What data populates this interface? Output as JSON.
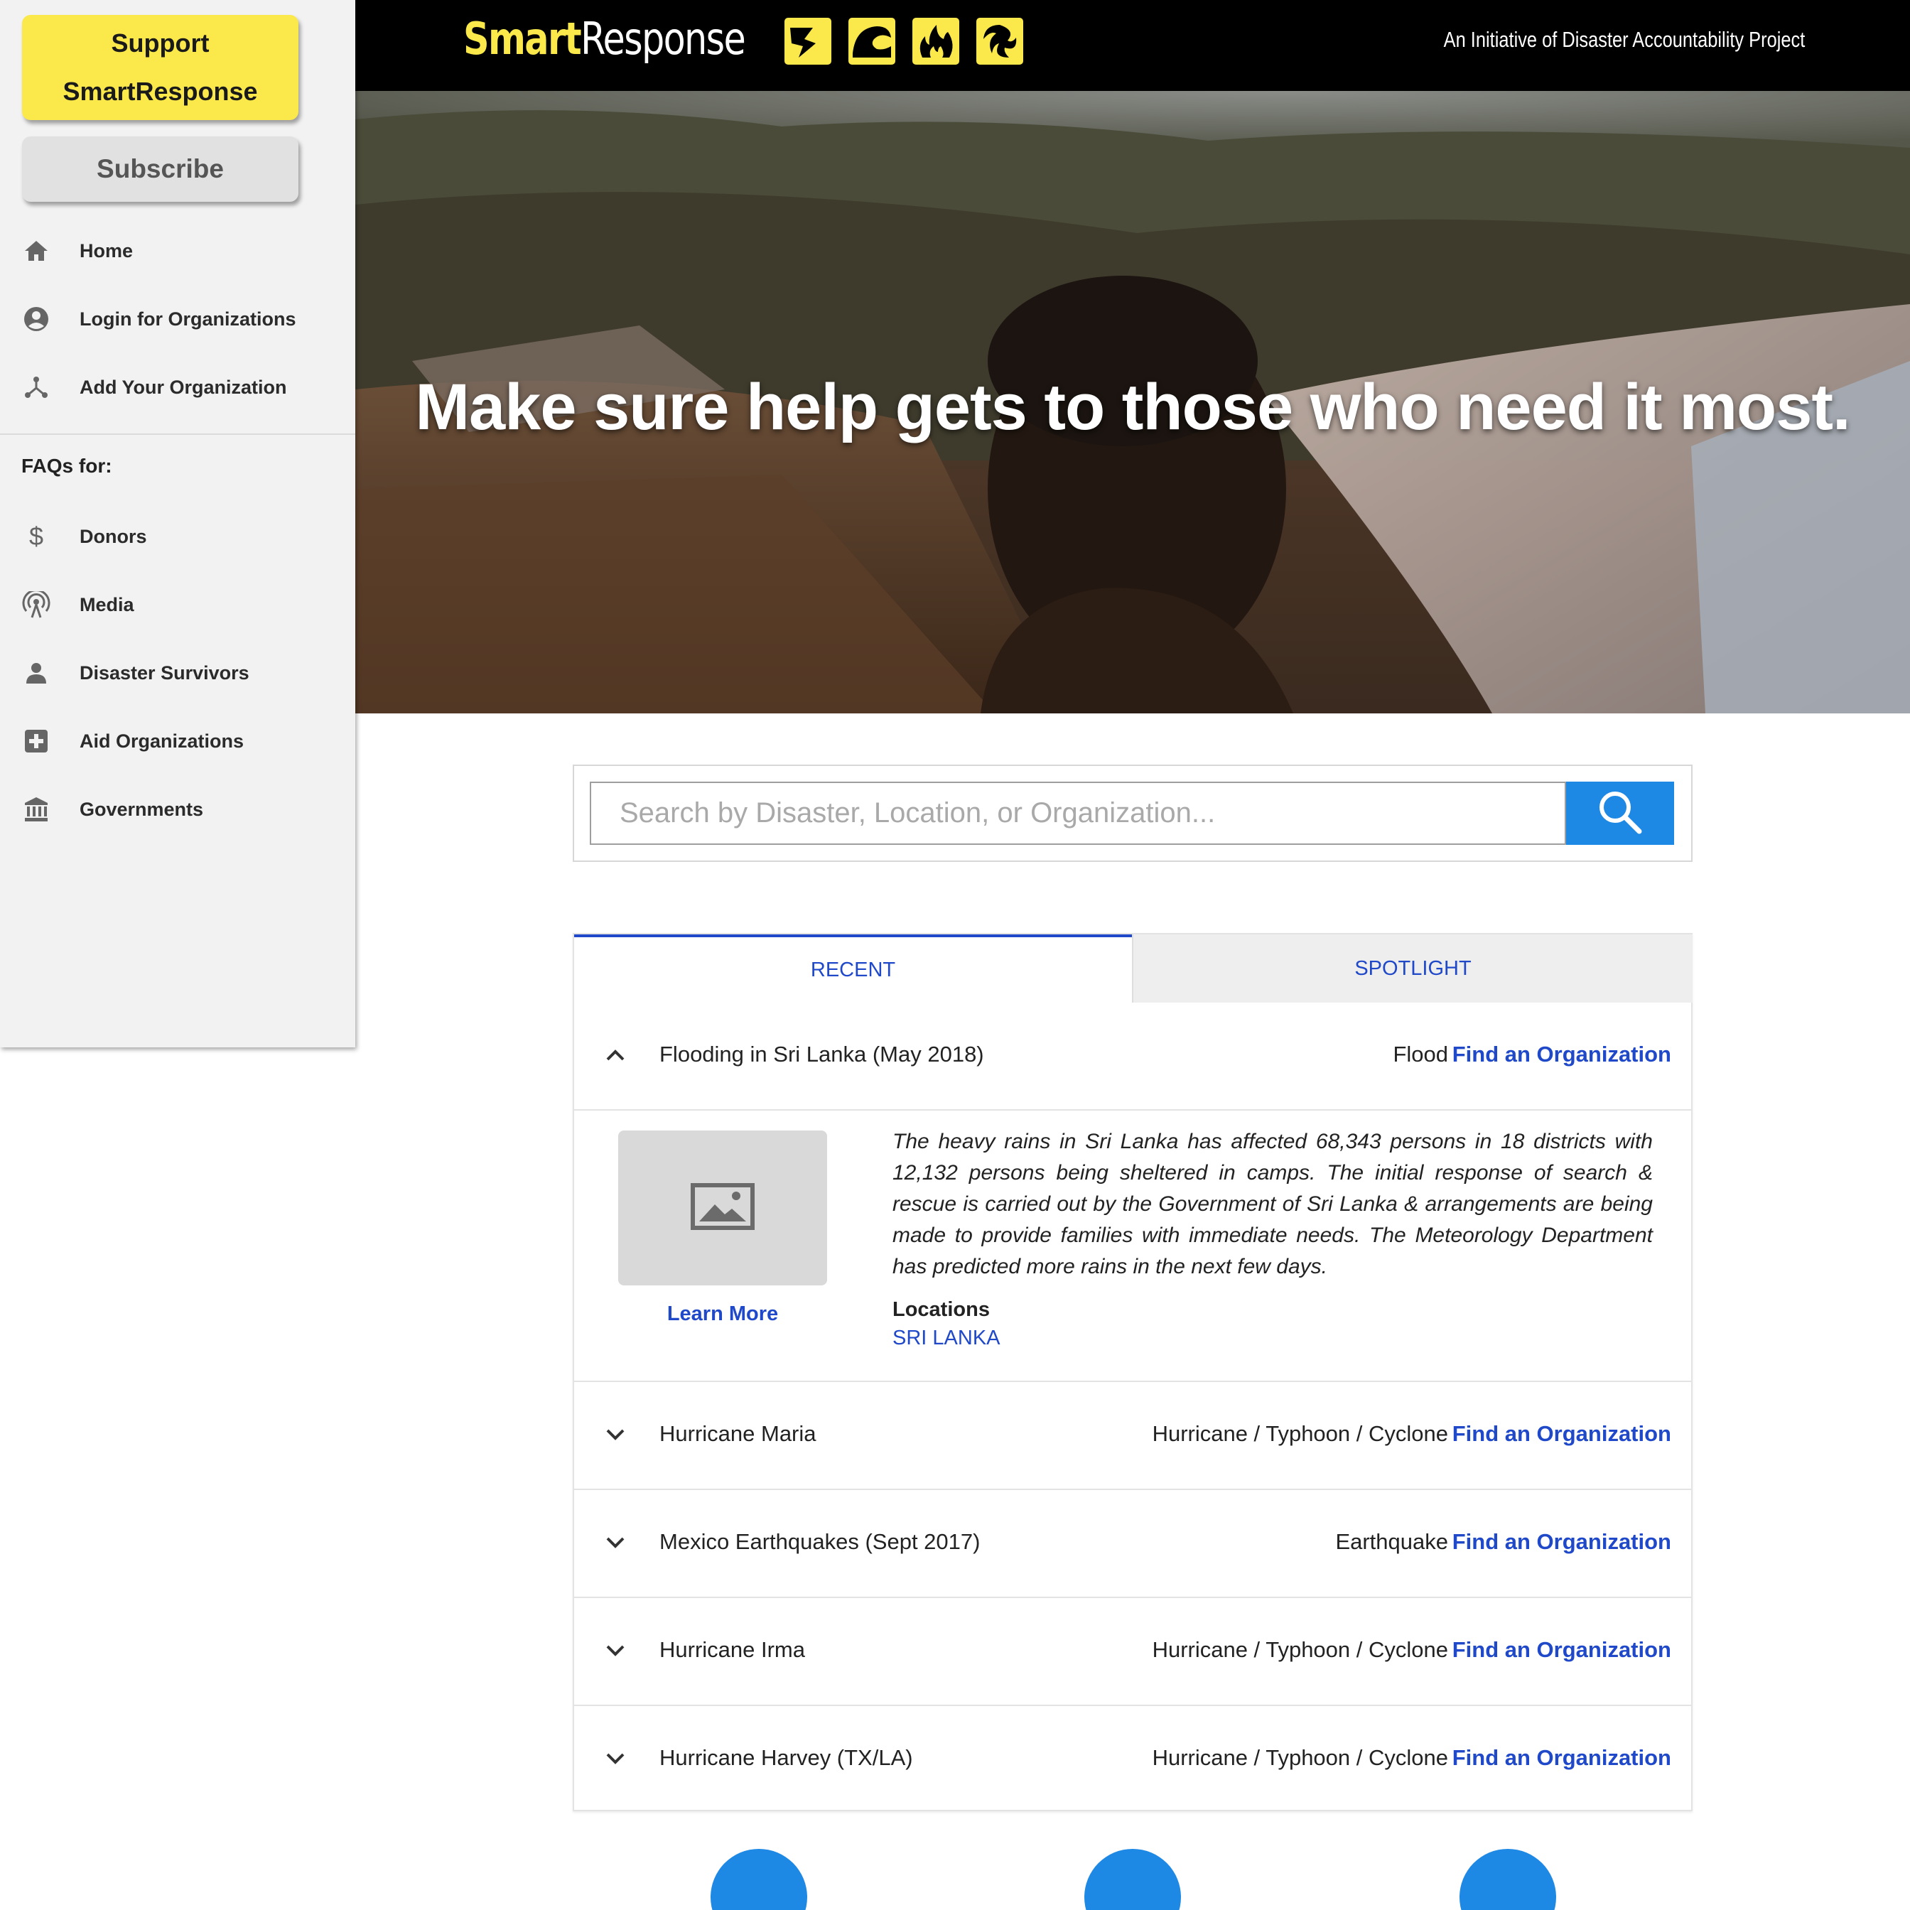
{
  "sidebar": {
    "support_label_1": "Support",
    "support_label_2": "SmartResponse",
    "subscribe_label": "Subscribe",
    "nav": [
      {
        "label": "Home",
        "icon": "home-icon"
      },
      {
        "label": "Login for Organizations",
        "icon": "account-circle-icon"
      },
      {
        "label": "Add Your Organization",
        "icon": "hierarchy-icon"
      }
    ],
    "faq_heading": "FAQs for:",
    "faq": [
      {
        "label": "Donors",
        "icon": "dollar-icon"
      },
      {
        "label": "Media",
        "icon": "broadcast-icon"
      },
      {
        "label": "Disaster Survivors",
        "icon": "person-icon"
      },
      {
        "label": "Aid Organizations",
        "icon": "medical-plus-icon"
      },
      {
        "label": "Governments",
        "icon": "bank-icon"
      }
    ]
  },
  "header": {
    "logo_smart": "Smart",
    "logo_response": "Response",
    "hazard_icons": [
      "earthquake-icon",
      "flood-wave-icon",
      "fire-icon",
      "hurricane-icon"
    ],
    "tagline": "An Initiative of Disaster Accountability Project"
  },
  "hero": {
    "headline": "Make sure help gets to those who need it most."
  },
  "search": {
    "placeholder": "Search by Disaster, Location, or Organization..."
  },
  "tabs": {
    "recent": "RECENT",
    "spotlight": "SPOTLIGHT"
  },
  "disasters": [
    {
      "title": "Flooding in Sri Lanka (May 2018)",
      "type": "Flood",
      "link": "Find an Organization",
      "expanded": true
    },
    {
      "title": "Hurricane Maria",
      "type": "Hurricane / Typhoon / Cyclone",
      "link": "Find an Organization"
    },
    {
      "title": "Mexico Earthquakes (Sept 2017)",
      "type": "Earthquake",
      "link": "Find an Organization"
    },
    {
      "title": "Hurricane Irma",
      "type": "Hurricane / Typhoon / Cyclone",
      "link": "Find an Organization"
    },
    {
      "title": "Hurricane Harvey (TX/LA)",
      "type": "Hurricane / Typhoon / Cyclone",
      "link": "Find an Organization"
    }
  ],
  "detail": {
    "description": "The heavy rains in Sri Lanka has affected 68,343 persons in 18 districts with 12,132 persons being sheltered in camps. The initial response of search & rescue is carried out by the Government of Sri Lanka & arrangements are being made to provide families with immediate needs.  The Meteorology Department has predicted more rains in the next few days.",
    "learn_more": "Learn More",
    "locations_heading": "Locations",
    "location": "SRI LANKA"
  },
  "colors": {
    "brand_yellow": "#fbe94b",
    "link_blue": "#1f49c8",
    "search_blue": "#1e88e5"
  }
}
